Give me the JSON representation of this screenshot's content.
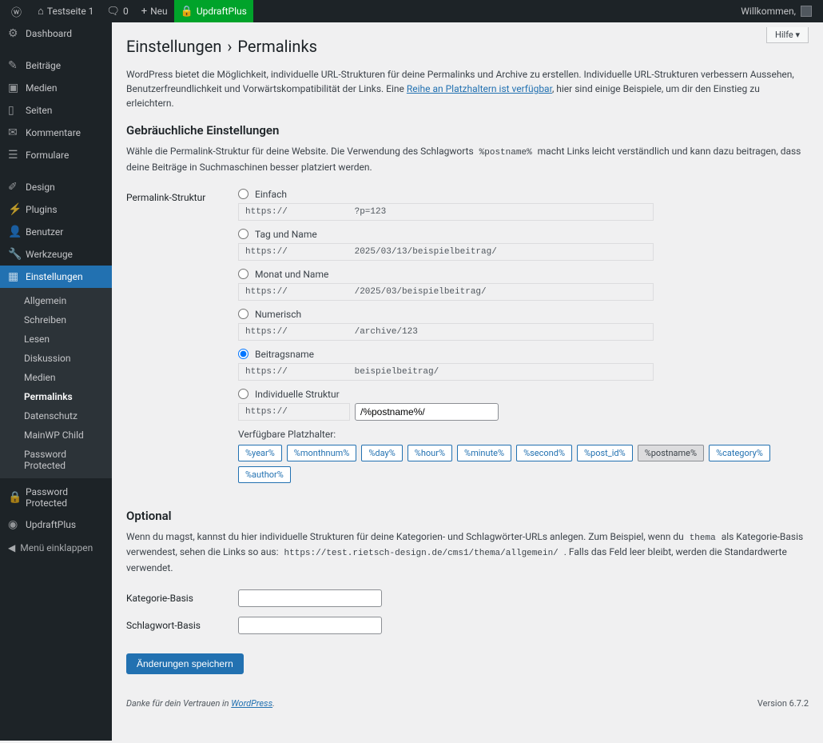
{
  "adminbar": {
    "site_name": "Testseite 1",
    "comments_count": "0",
    "new_label": "Neu",
    "updraft_label": "UpdraftPlus",
    "welcome": "Willkommen,",
    "help": "Hilfe"
  },
  "sidebar": {
    "items": [
      {
        "icon": "⚙",
        "label": "Dashboard"
      },
      {
        "sep": true
      },
      {
        "icon": "✎",
        "label": "Beiträge"
      },
      {
        "icon": "▣",
        "label": "Medien"
      },
      {
        "icon": "▯",
        "label": "Seiten"
      },
      {
        "icon": "✉",
        "label": "Kommentare"
      },
      {
        "icon": "☰",
        "label": "Formulare"
      },
      {
        "sep": true
      },
      {
        "icon": "✐",
        "label": "Design"
      },
      {
        "icon": "⚡",
        "label": "Plugins"
      },
      {
        "icon": "👤",
        "label": "Benutzer"
      },
      {
        "icon": "🔧",
        "label": "Werkzeuge"
      },
      {
        "icon": "▦",
        "label": "Einstellungen",
        "current": true
      }
    ],
    "submenu": [
      {
        "label": "Allgemein"
      },
      {
        "label": "Schreiben"
      },
      {
        "label": "Lesen"
      },
      {
        "label": "Diskussion"
      },
      {
        "label": "Medien"
      },
      {
        "label": "Permalinks",
        "current": true
      },
      {
        "label": "Datenschutz"
      },
      {
        "label": "MainWP Child"
      },
      {
        "label": "Password Protected"
      }
    ],
    "extra": [
      {
        "icon": "🔒",
        "label": "Password Protected"
      },
      {
        "icon": "◉",
        "label": "UpdraftPlus"
      }
    ],
    "collapse": "Menü einklappen"
  },
  "page": {
    "title_parent": "Einstellungen",
    "title_sep": "›",
    "title_current": "Permalinks",
    "intro_pre": "WordPress bietet die Möglichkeit, individuelle URL-Strukturen für deine Permalinks und Archive zu erstellen. Individuelle URL-Strukturen verbessern Aussehen, Benutzerfreundlichkeit und Vorwärtskompatibilität der Links. Eine ",
    "intro_link": "Reihe an Platzhaltern ist verfügbar",
    "intro_post": ", hier sind einige Beispiele, um dir den Einstieg zu erleichtern.",
    "common_heading": "Gebräuchliche Einstellungen",
    "common_desc_pre": "Wähle die Permalink-Struktur für deine Website. Die Verwendung des Schlagworts ",
    "common_desc_code": "%postname%",
    "common_desc_post": " macht Links leicht verständlich und kann dazu beitragen, dass deine Beiträge in Suchmaschinen besser platziert werden.",
    "structure_label": "Permalink-Struktur",
    "options": [
      {
        "label": "Einfach",
        "prefix": "https://",
        "suffix": "?p=123"
      },
      {
        "label": "Tag und Name",
        "prefix": "https://",
        "suffix": "2025/03/13/beispielbeitrag/"
      },
      {
        "label": "Monat und Name",
        "prefix": "https://",
        "suffix": "/2025/03/beispielbeitrag/"
      },
      {
        "label": "Numerisch",
        "prefix": "https://",
        "suffix": "/archive/123"
      },
      {
        "label": "Beitragsname",
        "prefix": "https://",
        "suffix": "beispielbeitrag/",
        "checked": true
      },
      {
        "label": "Individuelle Struktur",
        "prefix": "https://",
        "custom": true,
        "value": "/%postname%/"
      }
    ],
    "placeholders_label": "Verfügbare Platzhalter:",
    "placeholders": [
      "%year%",
      "%monthnum%",
      "%day%",
      "%hour%",
      "%minute%",
      "%second%",
      "%post_id%",
      "%postname%",
      "%category%",
      "%author%"
    ],
    "placeholder_active": "%postname%",
    "optional_heading": "Optional",
    "optional_desc_1": "Wenn du magst, kannst du hier individuelle Strukturen für deine Kategorien- und Schlagwörter-URLs anlegen. Zum Beispiel, wenn du ",
    "optional_code1": "thema",
    "optional_desc_2": " als Kategorie-Basis verwendest, sehen die Links so aus: ",
    "optional_code2": "https://test.rietsch-design.de/cms1/thema/allgemein/",
    "optional_desc_3": " . Falls das Feld leer bleibt, werden die Standardwerte verwendet.",
    "category_base_label": "Kategorie-Basis",
    "tag_base_label": "Schlagwort-Basis",
    "submit": "Änderungen speichern",
    "footer_thanks": "Danke für dein Vertrauen in ",
    "footer_link": "WordPress",
    "version": "Version 6.7.2"
  }
}
